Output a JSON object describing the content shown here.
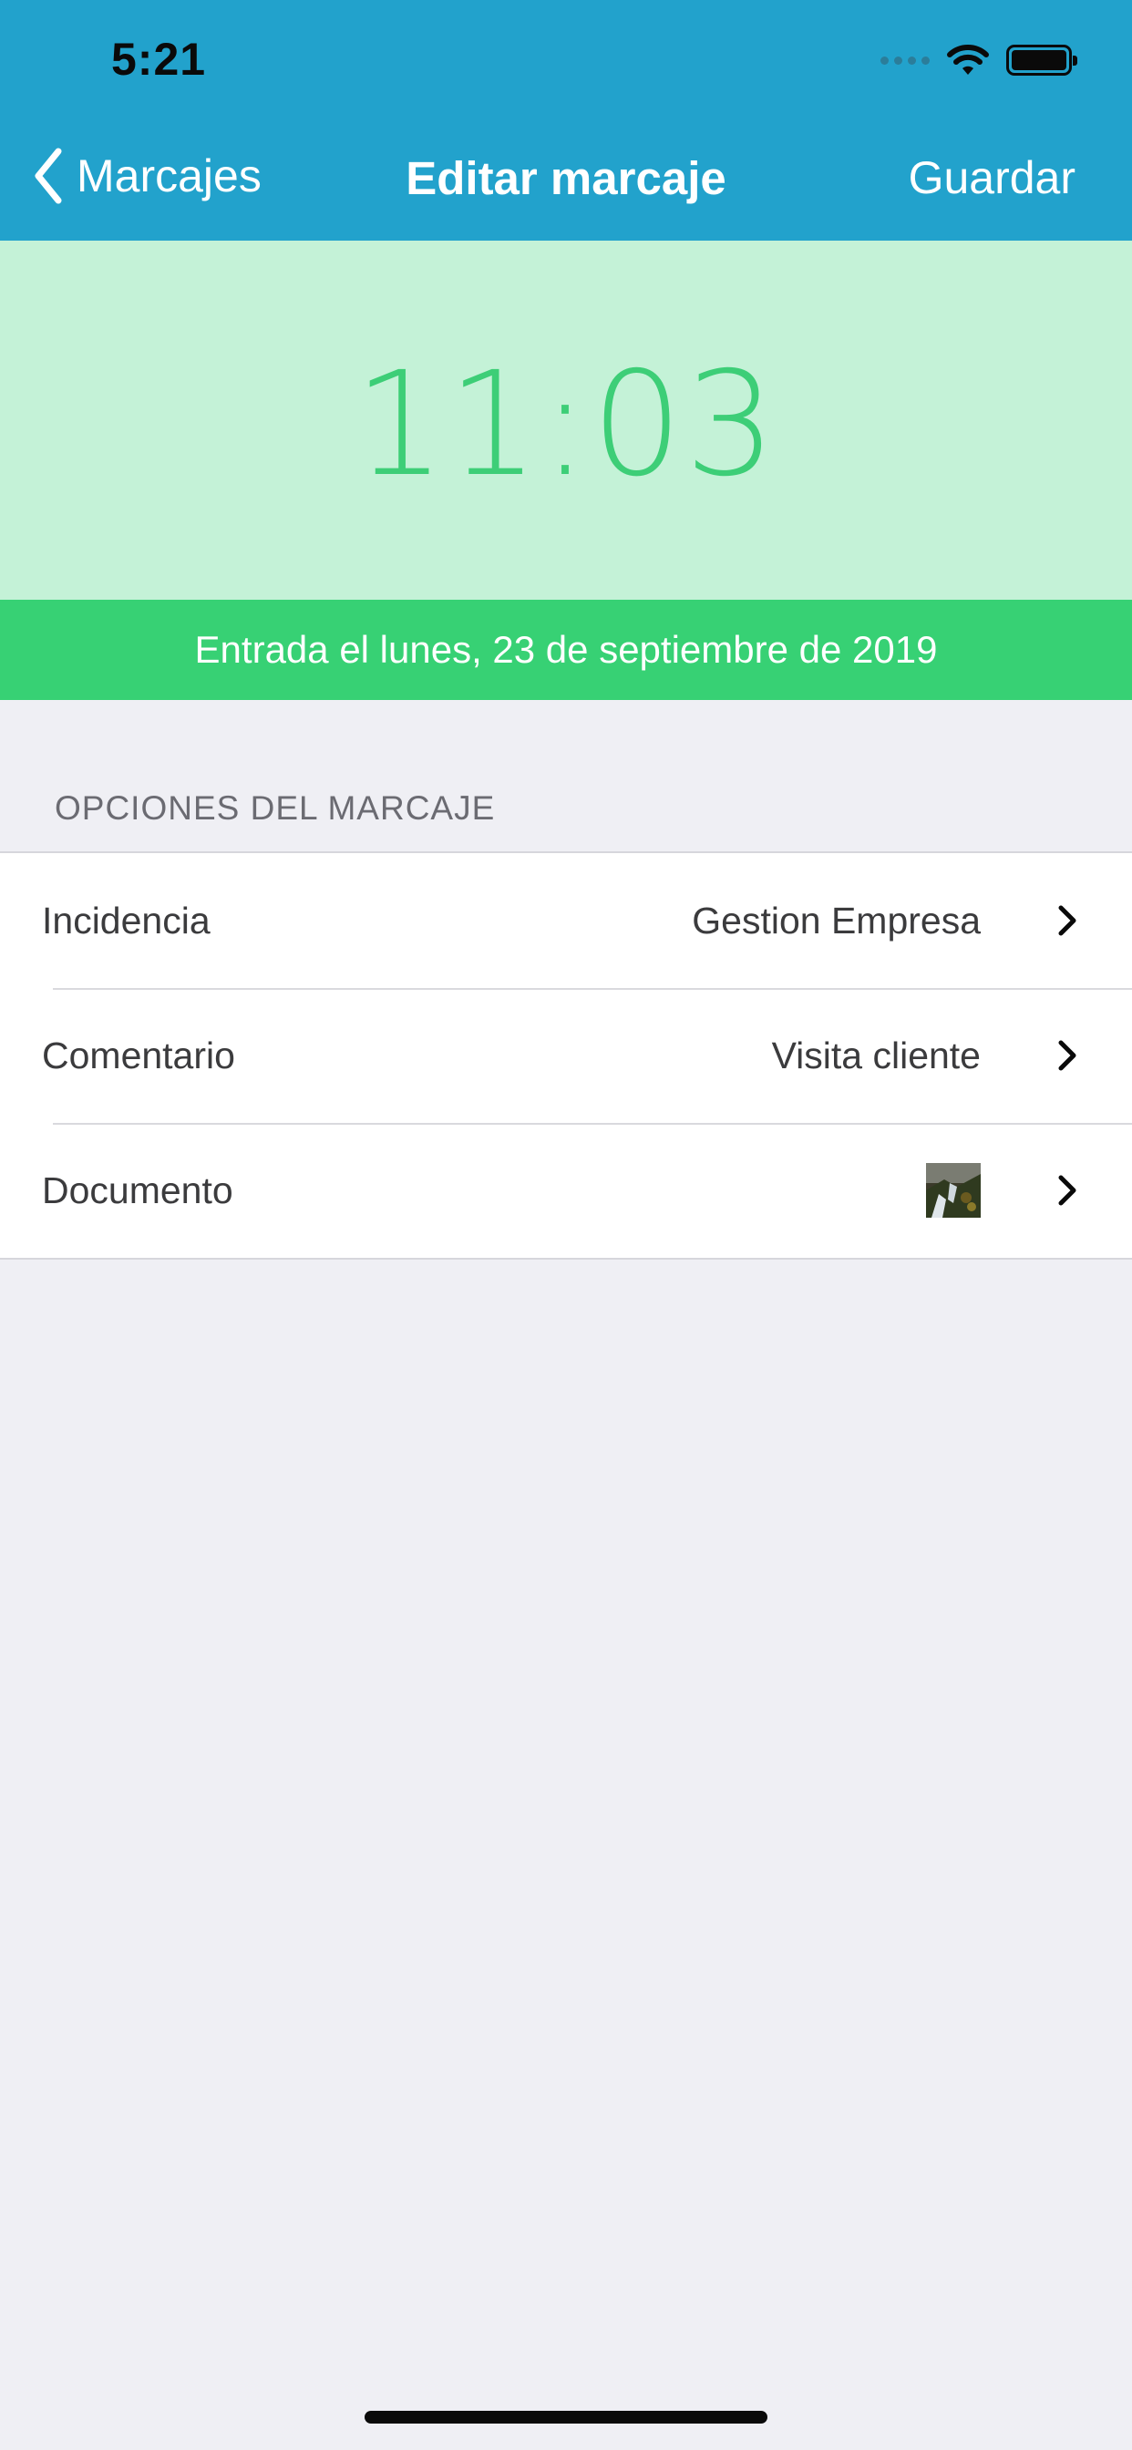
{
  "status_bar": {
    "time": "5:21",
    "icons": [
      "signal-icon",
      "wifi-icon",
      "battery-icon"
    ]
  },
  "nav": {
    "back_label": "Marcajes",
    "title": "Editar marcaje",
    "save_label": "Guardar"
  },
  "punch": {
    "time": "11:03",
    "date_text": "Entrada el lunes, 23 de septiembre de 2019"
  },
  "options": {
    "section_title": "OPCIONES DEL MARCAJE",
    "items": [
      {
        "label": "Incidencia",
        "value": "Gestion Empresa"
      },
      {
        "label": "Comentario",
        "value": "Visita cliente"
      },
      {
        "label": "Documento",
        "value": ""
      }
    ]
  },
  "colors": {
    "nav_bar": "#22a2cc",
    "time_panel": "#c4f2d7",
    "time_text": "#36cd72",
    "date_bar": "#37d174",
    "background": "#efeff4"
  }
}
